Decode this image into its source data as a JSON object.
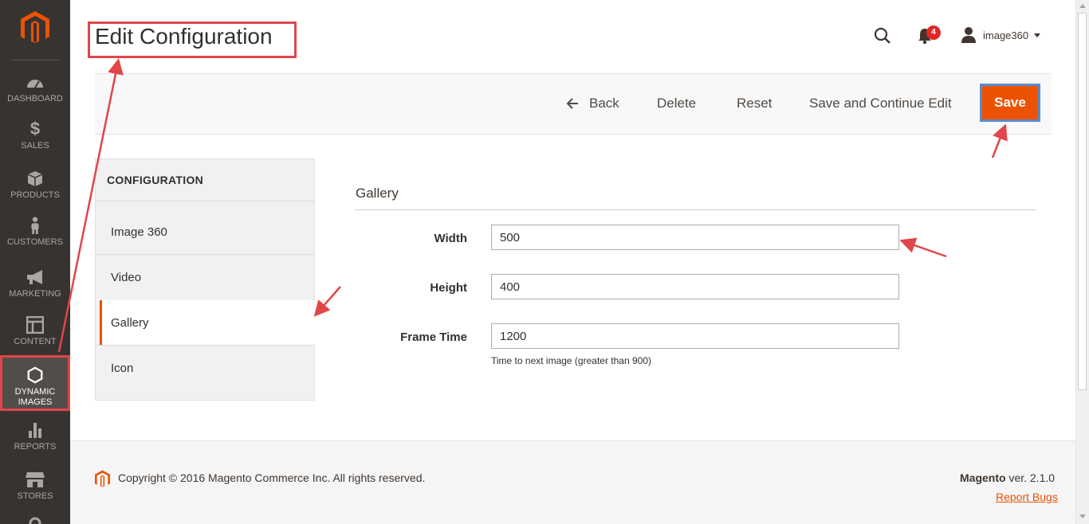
{
  "page": {
    "title": "Edit Configuration"
  },
  "sidebar": {
    "items": [
      {
        "label": "DASHBOARD",
        "icon": "dashboard-icon"
      },
      {
        "label": "SALES",
        "icon": "dollar-icon"
      },
      {
        "label": "PRODUCTS",
        "icon": "box-icon"
      },
      {
        "label": "CUSTOMERS",
        "icon": "person-icon"
      },
      {
        "label": "MARKETING",
        "icon": "megaphone-icon"
      },
      {
        "label": "CONTENT",
        "icon": "layout-icon"
      },
      {
        "label": "DYNAMIC IMAGES",
        "label_line1": "DYNAMIC",
        "label_line2": "IMAGES",
        "icon": "hexagon-icon",
        "active": true
      },
      {
        "label": "REPORTS",
        "icon": "bar-chart-icon"
      },
      {
        "label": "STORES",
        "icon": "store-icon"
      }
    ]
  },
  "header": {
    "notifications_count": "4",
    "user_name": "image360"
  },
  "actions": {
    "back": "Back",
    "delete": "Delete",
    "reset": "Reset",
    "save_continue": "Save and Continue Edit",
    "save": "Save"
  },
  "config_nav": {
    "title": "CONFIGURATION",
    "items": [
      "Image 360",
      "Video",
      "Gallery",
      "Icon"
    ],
    "active": "Gallery"
  },
  "section": {
    "title": "Gallery",
    "fields": [
      {
        "label": "Width",
        "value": "500"
      },
      {
        "label": "Height",
        "value": "400"
      },
      {
        "label": "Frame Time",
        "value": "1200",
        "note": "Time to next image (greater than 900)"
      }
    ]
  },
  "footer": {
    "copyright": "Copyright © 2016 Magento Commerce Inc. All rights reserved.",
    "product": "Magento",
    "version": " ver. 2.1.0",
    "report_bugs": "Report Bugs"
  },
  "colors": {
    "accent": "#eb5202",
    "sidebar_bg": "#373330",
    "annotation": "#e0464a"
  }
}
